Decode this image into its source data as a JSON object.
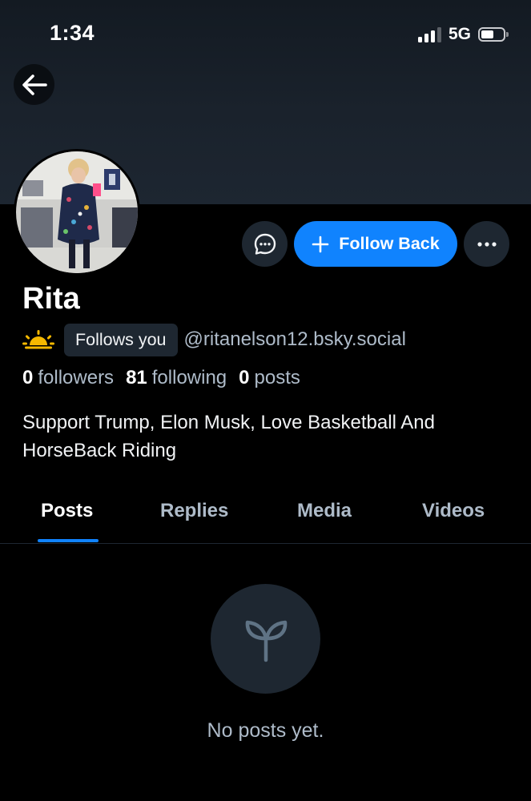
{
  "status_bar": {
    "time": "1:34",
    "network": "5G",
    "signal_bars_filled": 3,
    "signal_bars_total": 4,
    "battery_level": 0.5
  },
  "header": {
    "back_icon": "arrow-left-icon"
  },
  "profile": {
    "name": "Rita",
    "avatar_icon": "profile-photo",
    "status_emoji_icon": "sunrise-icon",
    "follows_you_label": "Follows you",
    "handle": "@ritanelson12.bsky.social",
    "stats": {
      "followers_count": "0",
      "followers_label": "followers",
      "following_count": "81",
      "following_label": "following",
      "posts_count": "0",
      "posts_label": "posts"
    },
    "bio": "Support Trump, Elon Musk, Love Basketball And HorseBack Riding"
  },
  "actions": {
    "message_icon": "chat-bubble-icon",
    "follow_label": "Follow Back",
    "follow_icon": "plus-icon",
    "more_icon": "ellipsis-icon"
  },
  "tabs": [
    {
      "label": "Posts",
      "active": true
    },
    {
      "label": "Replies",
      "active": false
    },
    {
      "label": "Media",
      "active": false
    },
    {
      "label": "Videos",
      "active": false
    }
  ],
  "empty_state": {
    "icon": "sprout-icon",
    "text": "No posts yet."
  },
  "colors": {
    "background": "#000000",
    "accent": "#1083fe",
    "secondary_text": "#aebbc9",
    "surface": "#1e2731",
    "emoji_yellow": "#f5b800"
  }
}
